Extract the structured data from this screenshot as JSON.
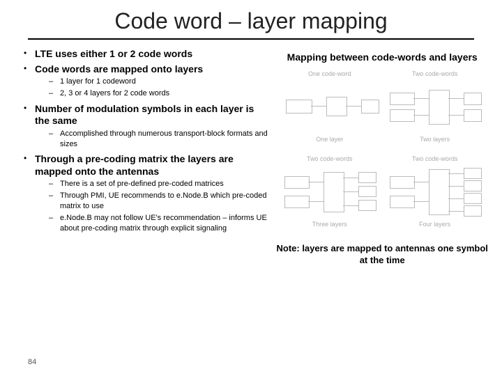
{
  "title": "Code word – layer mapping",
  "left": {
    "bullets": [
      {
        "text": "LTE uses either 1 or 2 code words",
        "sub": []
      },
      {
        "text": "Code words are mapped onto layers",
        "sub": [
          "1 layer  for 1 codeword",
          "2, 3 or 4 layers for 2 code words"
        ]
      },
      {
        "text": "Number of modulation symbols in each layer is the same",
        "sub": [
          "Accomplished through numerous transport-block formats and sizes"
        ]
      },
      {
        "text": "Through a pre-coding matrix the layers are mapped onto the antennas",
        "sub": [
          "There is a set of pre-defined pre-coded matrices",
          "Through PMI, UE recommends to e.Node.B which pre-coded matrix to use",
          "e.Node.B may not follow UE's recommendation – informs UE about pre-coding matrix through explicit signaling"
        ]
      }
    ]
  },
  "right": {
    "heading": "Mapping between code-words and layers",
    "cells": [
      {
        "caption": "One code-word",
        "label": "One layer"
      },
      {
        "caption": "Two code-words",
        "label": "Two layers"
      },
      {
        "caption": "Two code-words",
        "label": "Three layers"
      },
      {
        "caption": "Two code-words",
        "label": "Four layers"
      }
    ],
    "note": "Note: layers are mapped to antennas one symbol at the time"
  },
  "page": "84"
}
